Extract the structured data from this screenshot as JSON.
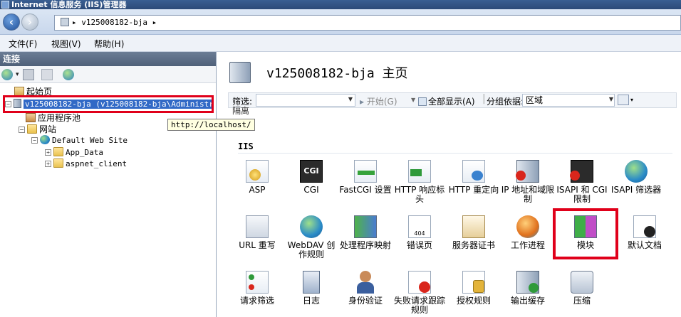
{
  "window": {
    "title": "Internet 信息服务 (IIS)管理器"
  },
  "address": {
    "path": "▸ v125008182-bja ▸"
  },
  "menu": {
    "items": [
      "文件(F)",
      "视图(V)",
      "帮助(H)"
    ]
  },
  "connections": {
    "header": "连接",
    "tree": {
      "start_page": "起始页",
      "server": "v125008182-bja (v125008182-bja\\Administrat",
      "app_pools": "应用程序池",
      "sites": "网站",
      "default_site": "Default Web Site",
      "app_data": "App_Data",
      "aspnet_client": "aspnet_client"
    },
    "tooltip": "http://localhost/"
  },
  "main": {
    "title": "v125008182-bja 主页",
    "filter": {
      "label": "筛选:",
      "start": "开始(G)",
      "show_all": "全部显示(A)",
      "group_by_label": "分组依据:",
      "group_by_value": "区域"
    },
    "partial_label": "隔离",
    "section_iis": "IIS",
    "features": [
      {
        "label": "ASP",
        "icon": "asp-icon"
      },
      {
        "label": "CGI",
        "icon": "cgi-icon"
      },
      {
        "label": "FastCGI 设置",
        "icon": "fastcgi-icon"
      },
      {
        "label": "HTTP 响应标头",
        "icon": "http-response-headers-icon"
      },
      {
        "label": "HTTP 重定向",
        "icon": "http-redirect-icon"
      },
      {
        "label": "IP 地址和域限制",
        "icon": "ip-restrictions-icon"
      },
      {
        "label": "ISAPI 和 CGI 限制",
        "icon": "isapi-cgi-restrictions-icon"
      },
      {
        "label": "ISAPI 筛选器",
        "icon": "isapi-filters-icon"
      },
      {
        "label": "URL 重写",
        "icon": "url-rewrite-icon"
      },
      {
        "label": "WebDAV 创作规则",
        "icon": "webdav-icon"
      },
      {
        "label": "处理程序映射",
        "icon": "handler-mappings-icon"
      },
      {
        "label": "错误页",
        "icon": "error-pages-icon"
      },
      {
        "label": "服务器证书",
        "icon": "server-certificates-icon"
      },
      {
        "label": "工作进程",
        "icon": "worker-processes-icon"
      },
      {
        "label": "模块",
        "icon": "modules-icon"
      },
      {
        "label": "默认文档",
        "icon": "default-document-icon"
      },
      {
        "label": "请求筛选",
        "icon": "request-filtering-icon"
      },
      {
        "label": "日志",
        "icon": "logging-icon"
      },
      {
        "label": "身份验证",
        "icon": "authentication-icon"
      },
      {
        "label": "失败请求跟踪规则",
        "icon": "failed-request-tracing-icon"
      },
      {
        "label": "授权规则",
        "icon": "authorization-rules-icon"
      },
      {
        "label": "输出缓存",
        "icon": "output-caching-icon"
      },
      {
        "label": "压缩",
        "icon": "compression-icon"
      }
    ]
  },
  "colors": {
    "highlight_red": "#e0001a",
    "selection_blue": "#3169c6"
  }
}
